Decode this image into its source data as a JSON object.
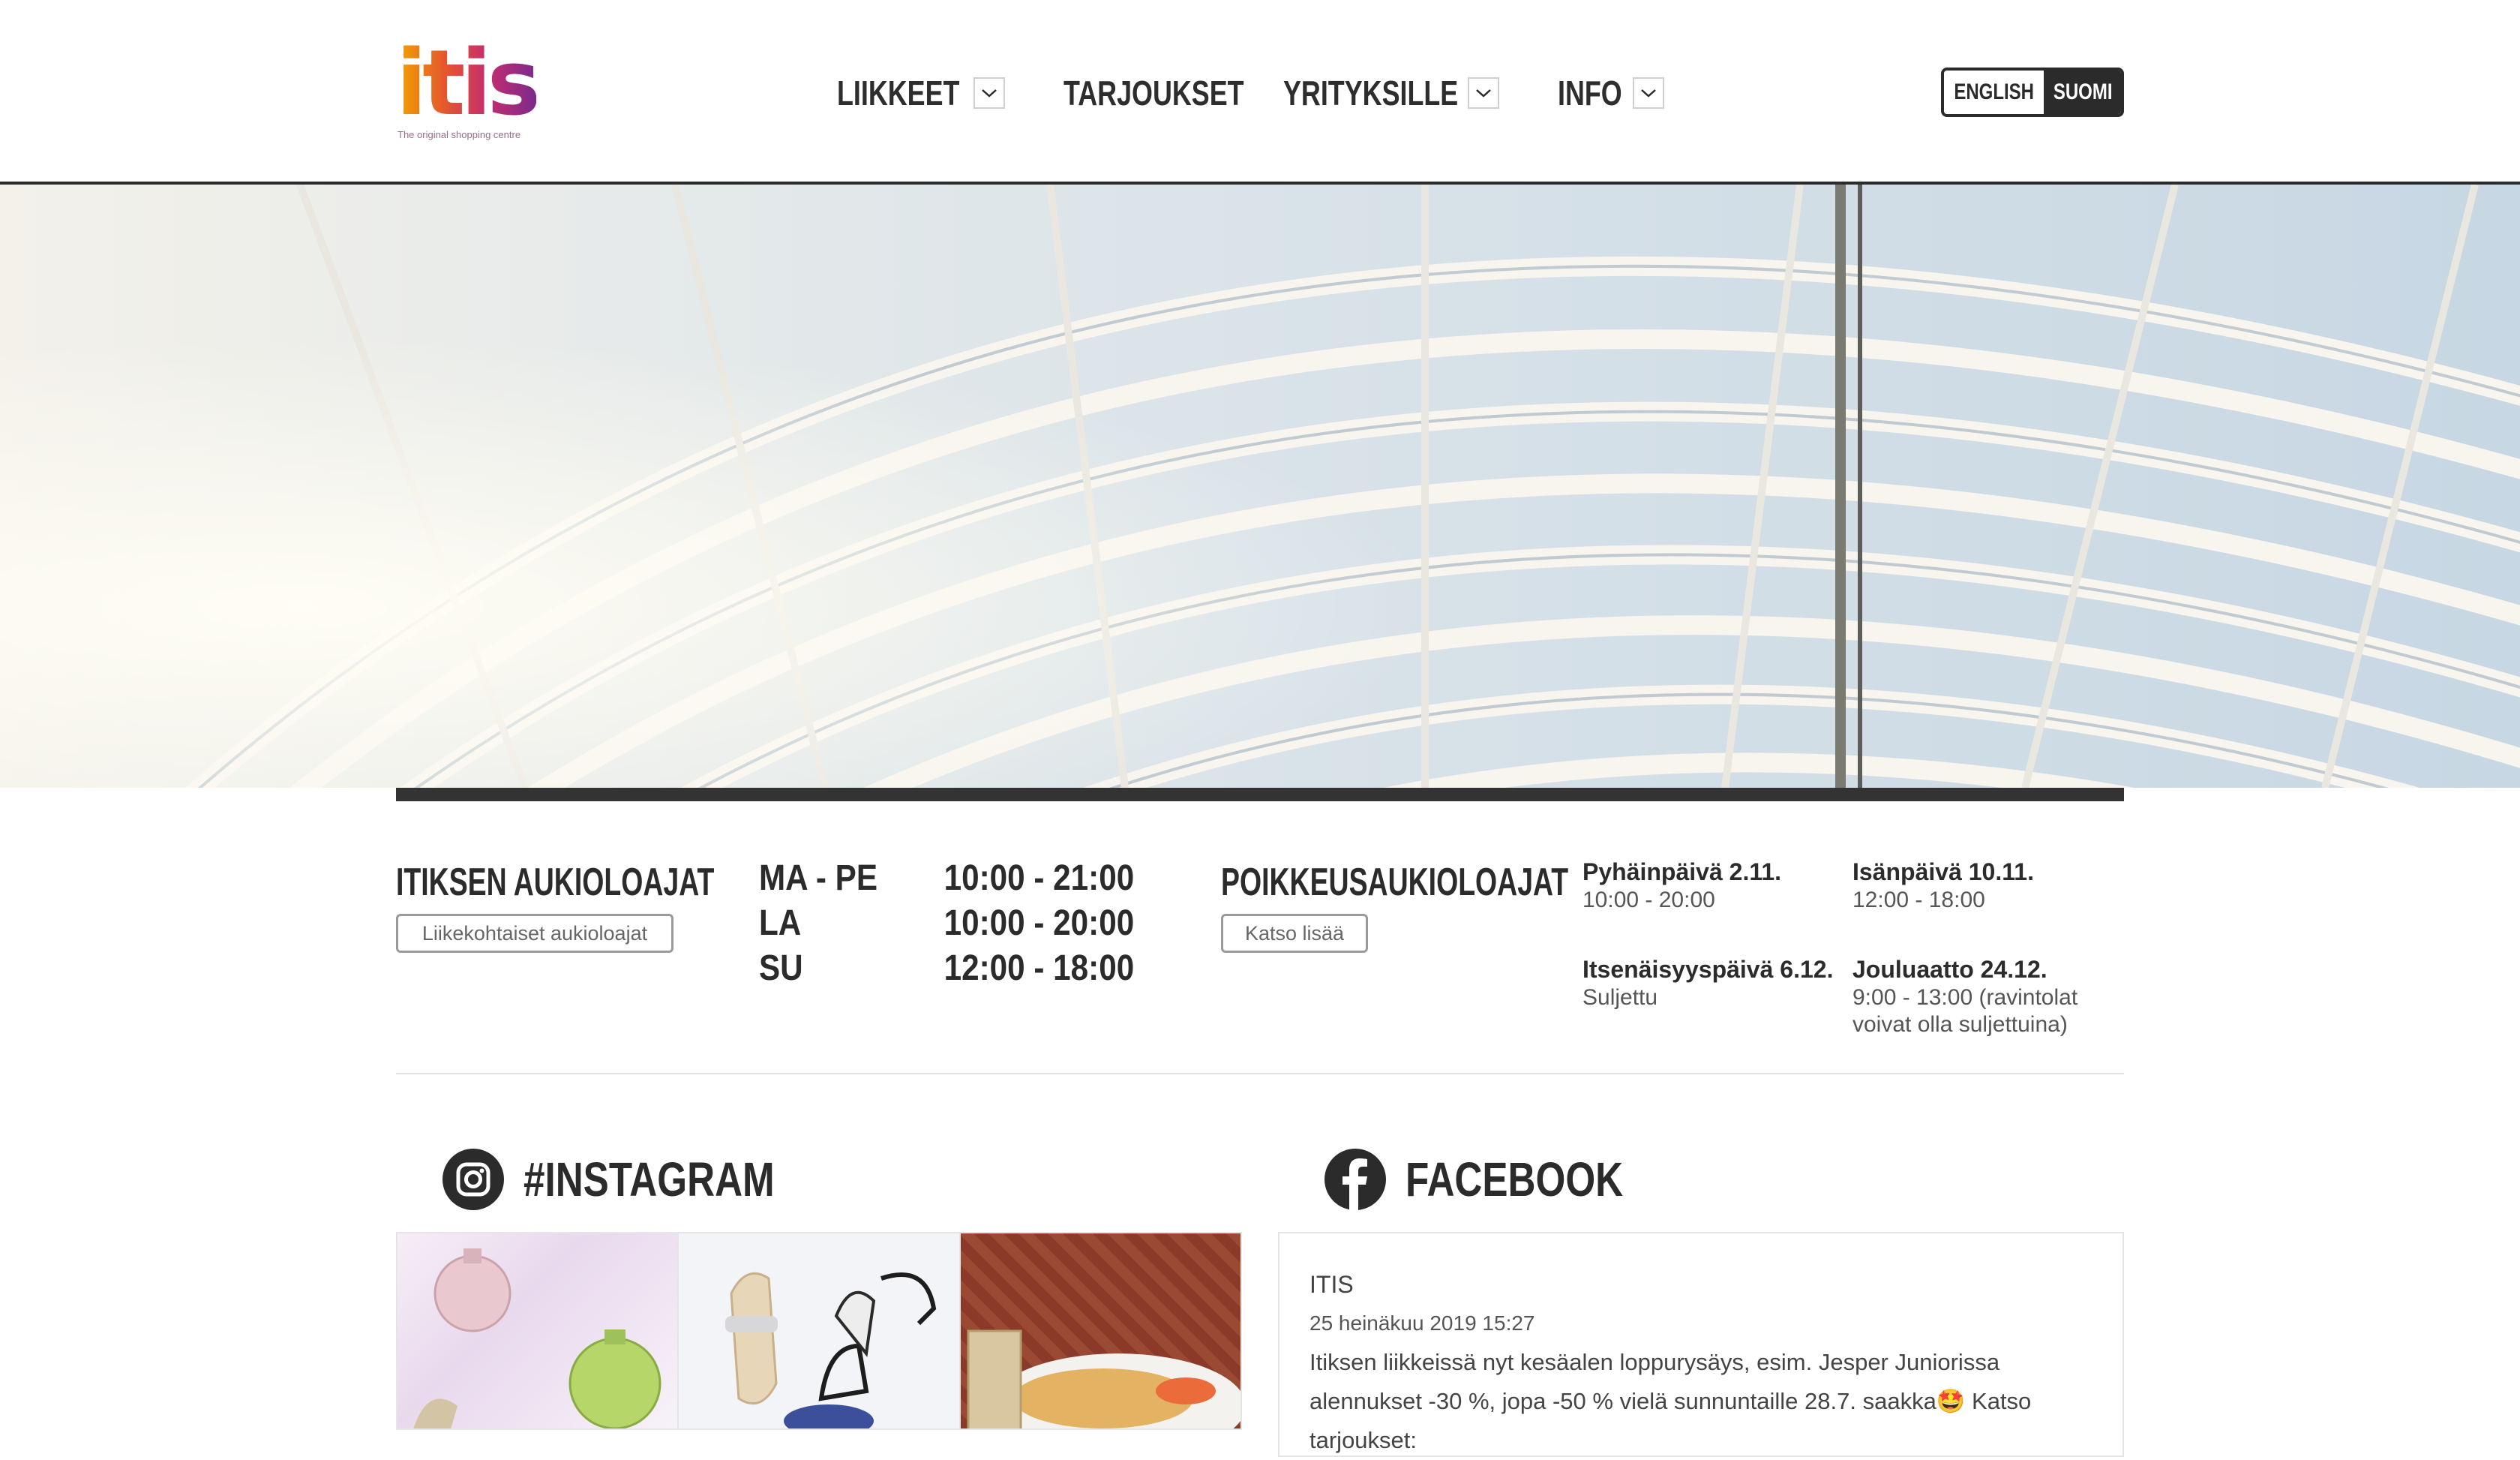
{
  "logo": {
    "text": "itis",
    "tagline": "The original shopping centre"
  },
  "nav": {
    "items": [
      {
        "label": "LIIKKEET",
        "has_dropdown": true
      },
      {
        "label": "TARJOUKSET",
        "has_dropdown": false
      },
      {
        "label": "YRITYKSILLE",
        "has_dropdown": true
      },
      {
        "label": "INFO",
        "has_dropdown": true
      }
    ]
  },
  "lang": {
    "english": "ENGLISH",
    "suomi": "SUOMI",
    "active": "SUOMI"
  },
  "hours": {
    "title": "ITIKSEN AUKIOLOAJAT",
    "button": "Liikekohtaiset aukioloajat",
    "rows": [
      {
        "day": "MA - PE",
        "time": "10:00 - 21:00"
      },
      {
        "day": "LA",
        "time": "10:00 - 20:00"
      },
      {
        "day": "SU",
        "time": "12:00 - 18:00"
      }
    ]
  },
  "exceptions": {
    "title": "POIKKEUSAUKIOLOAJAT",
    "button": "Katso lisää",
    "items": [
      {
        "name": "Pyhäinpäivä 2.11.",
        "value": "10:00 - 20:00"
      },
      {
        "name": "Isänpäivä 10.11.",
        "value": "12:00 - 18:00"
      },
      {
        "name": "Itsenäisyyspäivä 6.12.",
        "value": "Suljettu"
      },
      {
        "name": "Jouluaatto 24.12.",
        "value": "9:00 - 13:00 (ravintolat voivat olla suljettuina)"
      }
    ]
  },
  "instagram": {
    "title": "#INSTAGRAM"
  },
  "facebook": {
    "title": "FACEBOOK",
    "post": {
      "author": "ITIS",
      "date": "25 heinäkuu 2019 15:27",
      "text": "Itiksen liikkeissä nyt kesäalen loppurysäys, esim. Jesper Juniorissa alennukset -30 %, jopa -50 % vielä sunnuntaille 28.7. saakka🤩 Katso tarjoukset:"
    }
  },
  "colors": {
    "dark": "#2b2b2b",
    "brand_orange": "#f2a400",
    "brand_magenta": "#c62d6e",
    "brand_purple": "#7b2a8c"
  }
}
